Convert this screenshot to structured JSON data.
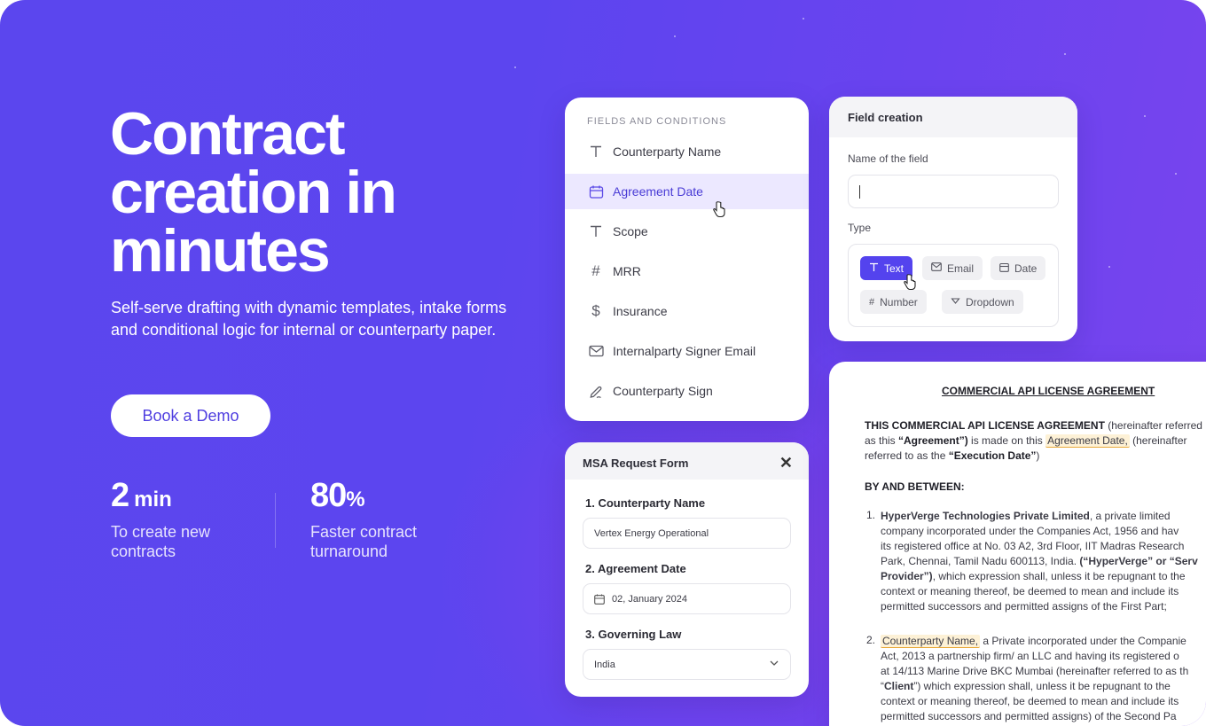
{
  "hero": {
    "headline": "Contract creation in minutes",
    "subline": "Self-serve drafting with dynamic templates, intake forms and conditional logic for internal or counterparty paper.",
    "cta": "Book a Demo",
    "stats": [
      {
        "value": "2",
        "unit": "min",
        "desc": "To create new contracts"
      },
      {
        "value": "80",
        "unit": "%",
        "desc": "Faster contract turnaround"
      }
    ]
  },
  "fields": {
    "title": "FIELDS AND CONDITIONS",
    "items": [
      {
        "label": "Counterparty Name",
        "icon": "text-icon"
      },
      {
        "label": "Agreement Date",
        "icon": "calendar-icon",
        "active": true
      },
      {
        "label": "Scope",
        "icon": "text-icon"
      },
      {
        "label": "MRR",
        "icon": "hash-icon"
      },
      {
        "label": "Insurance",
        "icon": "dollar-icon"
      },
      {
        "label": "Internalparty Signer Email",
        "icon": "mail-icon"
      },
      {
        "label": "Counterparty Sign",
        "icon": "signature-icon"
      }
    ]
  },
  "creation": {
    "title": "Field creation",
    "name_label": "Name of the field",
    "type_label": "Type",
    "types": [
      "Text",
      "Email",
      "Date",
      "Number",
      "Dropdown"
    ],
    "selected_type": "Text"
  },
  "msa": {
    "title": "MSA Request Form",
    "questions": [
      {
        "label": "1. Counterparty Name",
        "value": "Vertex Energy Operational"
      },
      {
        "label": "2. Agreement Date",
        "value": "02, January 2024"
      },
      {
        "label": "3. Governing Law",
        "value": "India"
      }
    ]
  },
  "doc": {
    "title": "COMMERCIAL API LICENSE AGREEMENT",
    "intro_bold": "THIS COMMERCIAL API LICENSE AGREEMENT",
    "intro_1": " (hereinafter referred",
    "intro_2a": "as this ",
    "intro_2b": "“Agreement”)",
    "intro_2c": " is made on this ",
    "intro_2d": "Agreement Date,",
    "intro_2e": " (hereinafter",
    "intro_3a": "referred to as the ",
    "intro_3b": "“Execution Date”",
    "intro_3c": ")",
    "between": "BY AND BETWEEN:",
    "p1_num": "1.",
    "p1_l1a": "HyperVerge Technologies Private Limited",
    "p1_l1b": ", a private limited",
    "p1_l2": "company   incorporated under the Companies Act, 1956 and hav",
    "p1_l3": "its registered office at No. 03 A2, 3rd Floor, IIT Madras Research",
    "p1_l4a": "Park, Chennai, Tamil Nadu 600113, India. ",
    "p1_l4b": "(“HyperVerge” or “Serv",
    "p1_l5a": "Provider”)",
    "p1_l5b": ", which expression shall, unless it be repugnant to the",
    "p1_l6": "context or meaning thereof, be deemed to mean and include its",
    "p1_l7": "permitted successors and permitted assigns of the First Part;",
    "p2_num": "2.",
    "p2_l1a": "Counterparty Name,",
    "p2_l1b": " a Private incorporated under the Companie",
    "p2_l2": "Act, 2013 a partnership   firm/ an LLC and having its registered o",
    "p2_l3": "at 14/113 Marine Drive BKC Mumbai (hereinafter referred to as th",
    "p2_l4a": "“",
    "p2_l4b": "Client",
    "p2_l4c": "”) which expression shall, unless it be repugnant to the",
    "p2_l5": "context or meaning thereof, be deemed to mean and include its",
    "p2_l6": "permitted successors and permitted assigns) of the Second Pa"
  }
}
